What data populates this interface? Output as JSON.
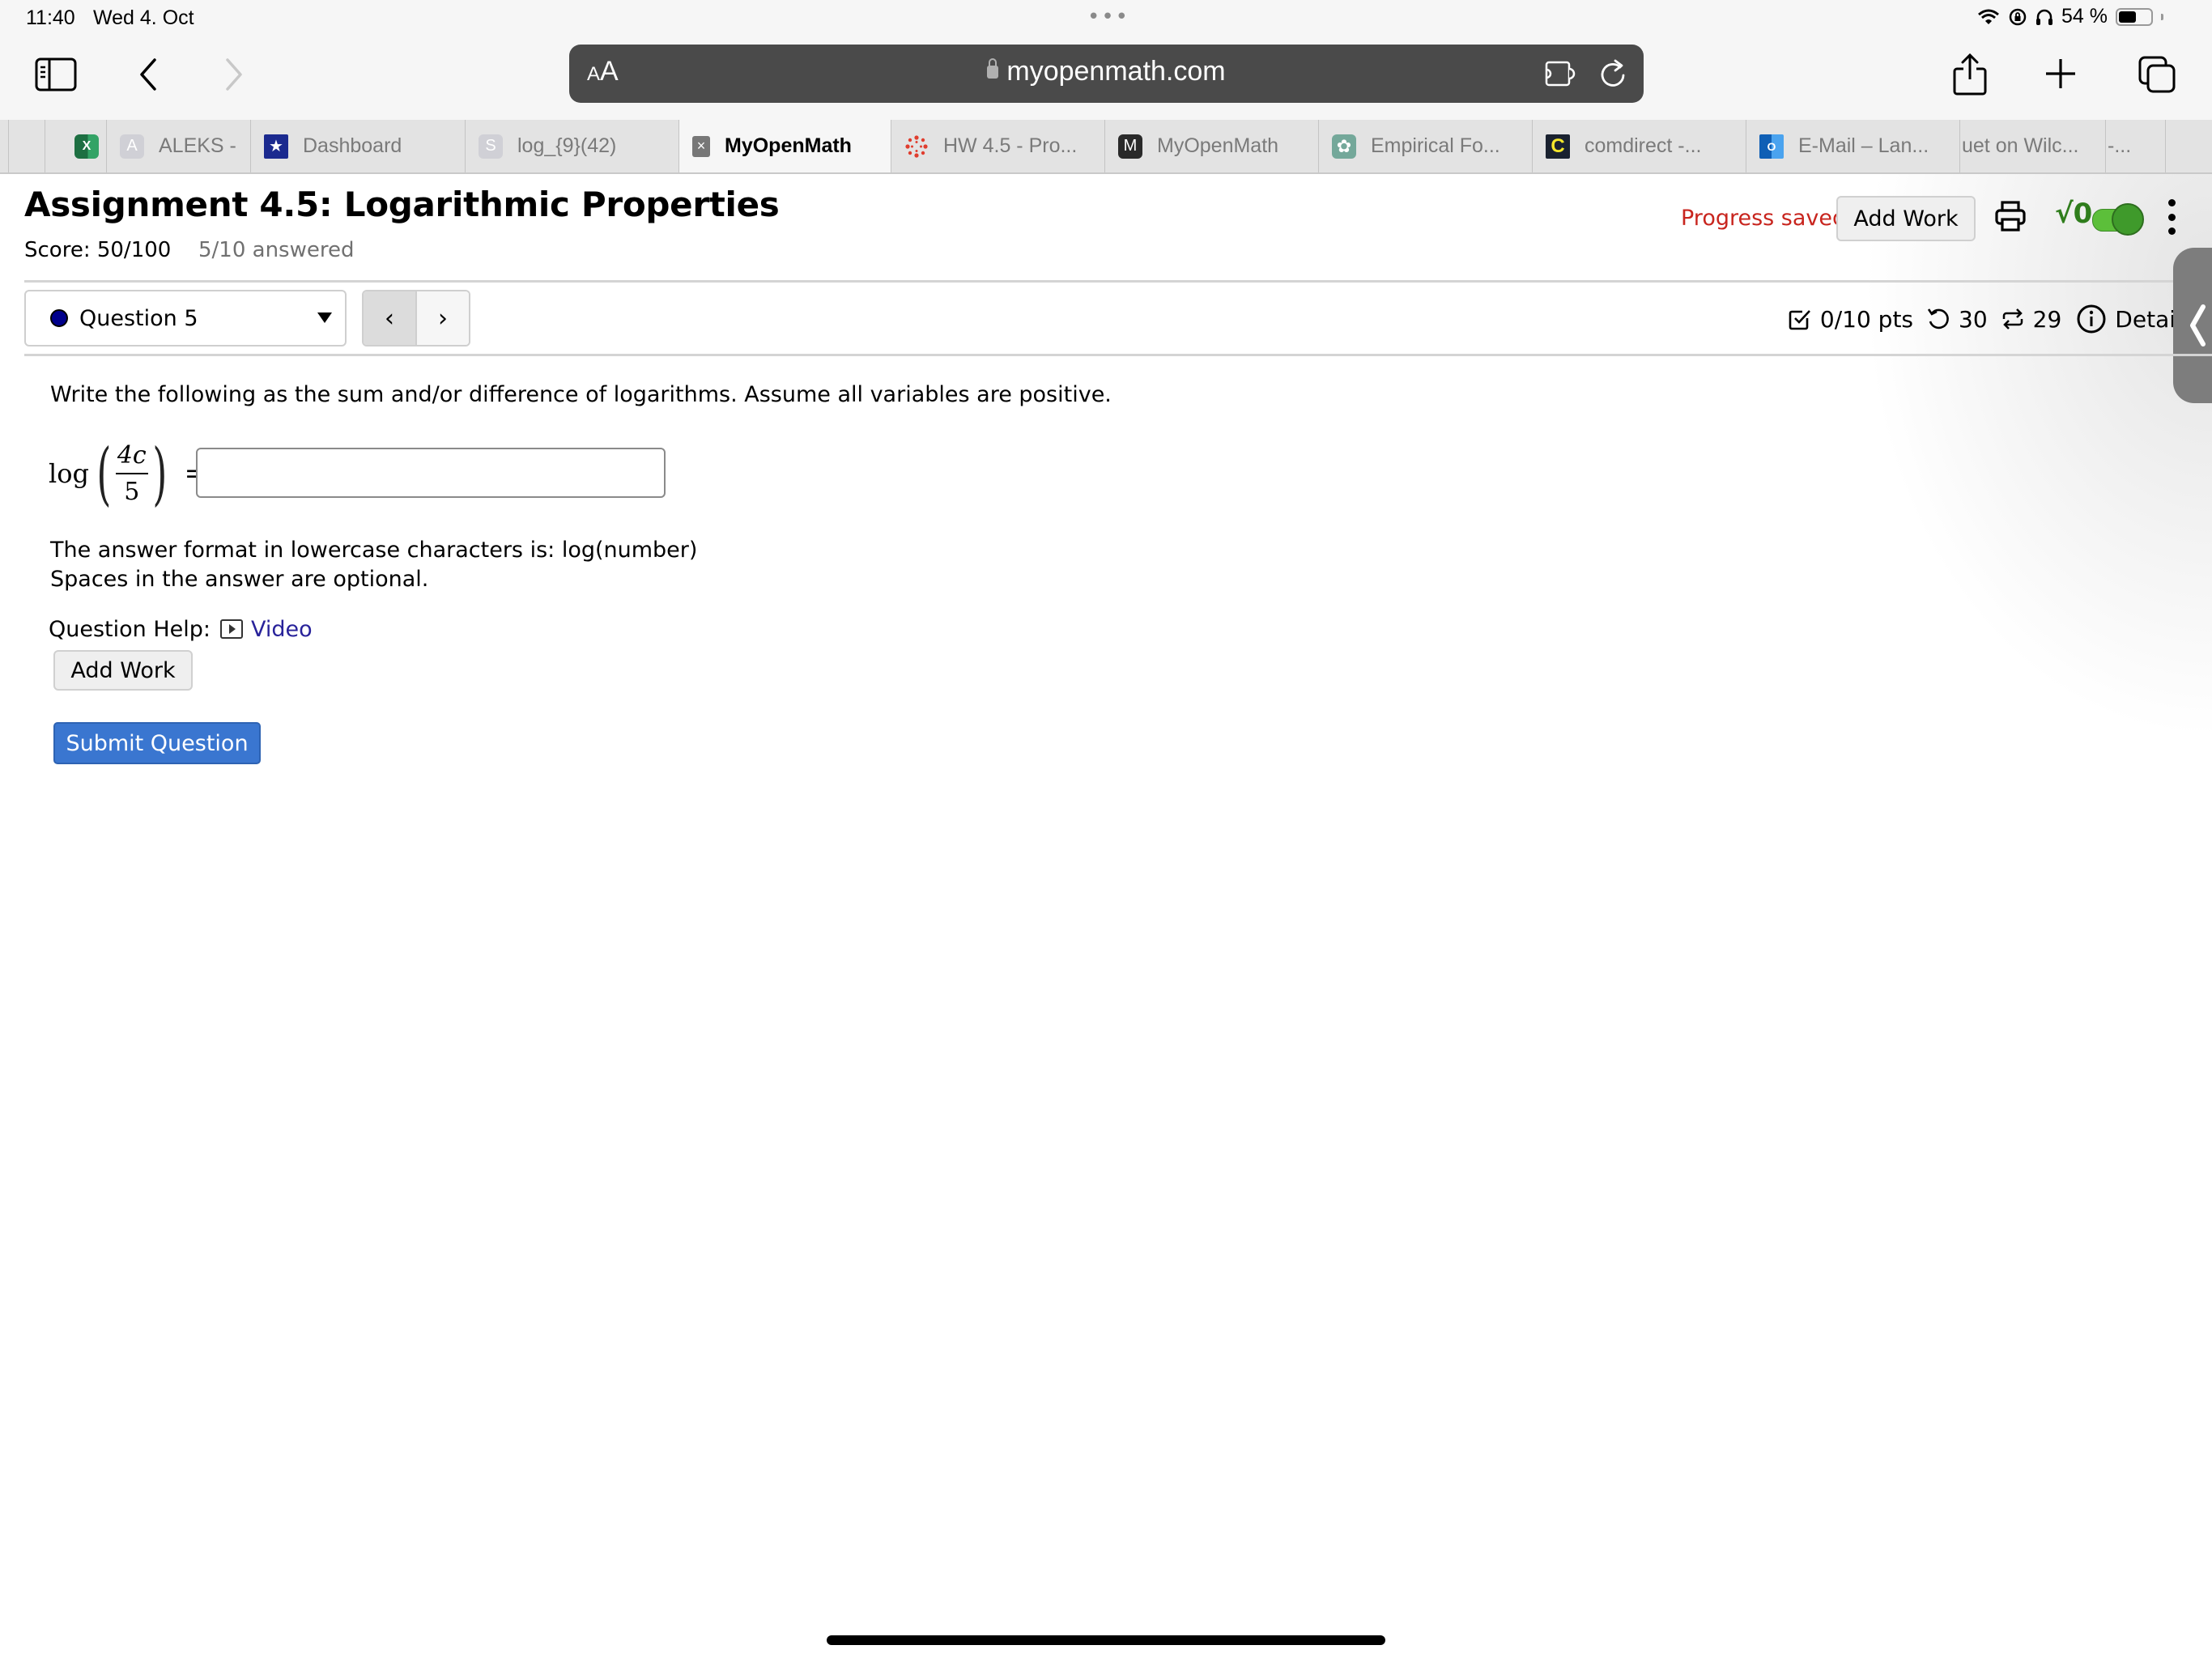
{
  "status_bar": {
    "time": "11:40",
    "date": "Wed 4. Oct",
    "battery_text": "54 %",
    "battery_level": 0.54,
    "icons": [
      "wifi-icon",
      "orientation-lock-icon",
      "headphones-icon",
      "battery-icon"
    ]
  },
  "toolbar": {
    "reader_label_small": "A",
    "reader_label_large": "A",
    "url": "myopenmath.com",
    "icons": [
      "sidebar-icon",
      "back-icon",
      "forward-icon",
      "lock-icon",
      "extension-icon",
      "reload-icon",
      "share-icon",
      "new-tab-icon",
      "tabs-overview-icon"
    ]
  },
  "tabs": [
    {
      "label": "",
      "favicon": "excel-icon"
    },
    {
      "label": "ALEKS -",
      "favicon": "A"
    },
    {
      "label": "Dashboard",
      "favicon": "star-shield-icon"
    },
    {
      "label": "log_{9}(42)",
      "favicon": "S"
    },
    {
      "label": "MyOpenMath",
      "favicon": "close-icon",
      "active": true
    },
    {
      "label": "HW 4.5 - Pro...",
      "favicon": "canvas-icon"
    },
    {
      "label": "MyOpenMath",
      "favicon": "M"
    },
    {
      "label": "Empirical Fo...",
      "favicon": "chatgpt-icon"
    },
    {
      "label": "comdirect -...",
      "favicon": "C"
    },
    {
      "label": "E-Mail – Lan...",
      "favicon": "outlook-icon"
    },
    {
      "label": "uet on Wilc...",
      "favicon": ""
    },
    {
      "label": "-...",
      "favicon": ""
    }
  ],
  "assignment": {
    "title": "Assignment 4.5: Logarithmic Properties",
    "score": "Score: 50/100",
    "answered": "5/10 answered",
    "progress_status": "Progress saved",
    "add_work_label": "Add Work",
    "math_toggle_label": "√0",
    "math_toggle_on": true
  },
  "question_nav": {
    "selected": "Question 5",
    "prev_label": "‹",
    "next_label": "›"
  },
  "question_info": {
    "points": "0/10 pts",
    "retries": "30",
    "regens": "29",
    "details_label": "Detai"
  },
  "question": {
    "prompt": "Write the following as the sum and/or difference of logarithms. Assume all variables are positive.",
    "expression": {
      "func": "log",
      "numerator": "4c",
      "denominator": "5",
      "equals": "="
    },
    "answer_value": "",
    "answer_placeholder": "",
    "hint_line1": "The answer format in lowercase characters is: log(number)",
    "hint_line2": "Spaces in the answer are optional.",
    "help_label": "Question Help:",
    "video_label": "Video",
    "add_work_label": "Add Work",
    "submit_label": "Submit Question"
  },
  "colors": {
    "progress_saved": "#c8251e",
    "submit_button": "#3a76d0",
    "link": "#28229a",
    "toggle": "#3f9a2b",
    "question_dot": "#00008b"
  }
}
